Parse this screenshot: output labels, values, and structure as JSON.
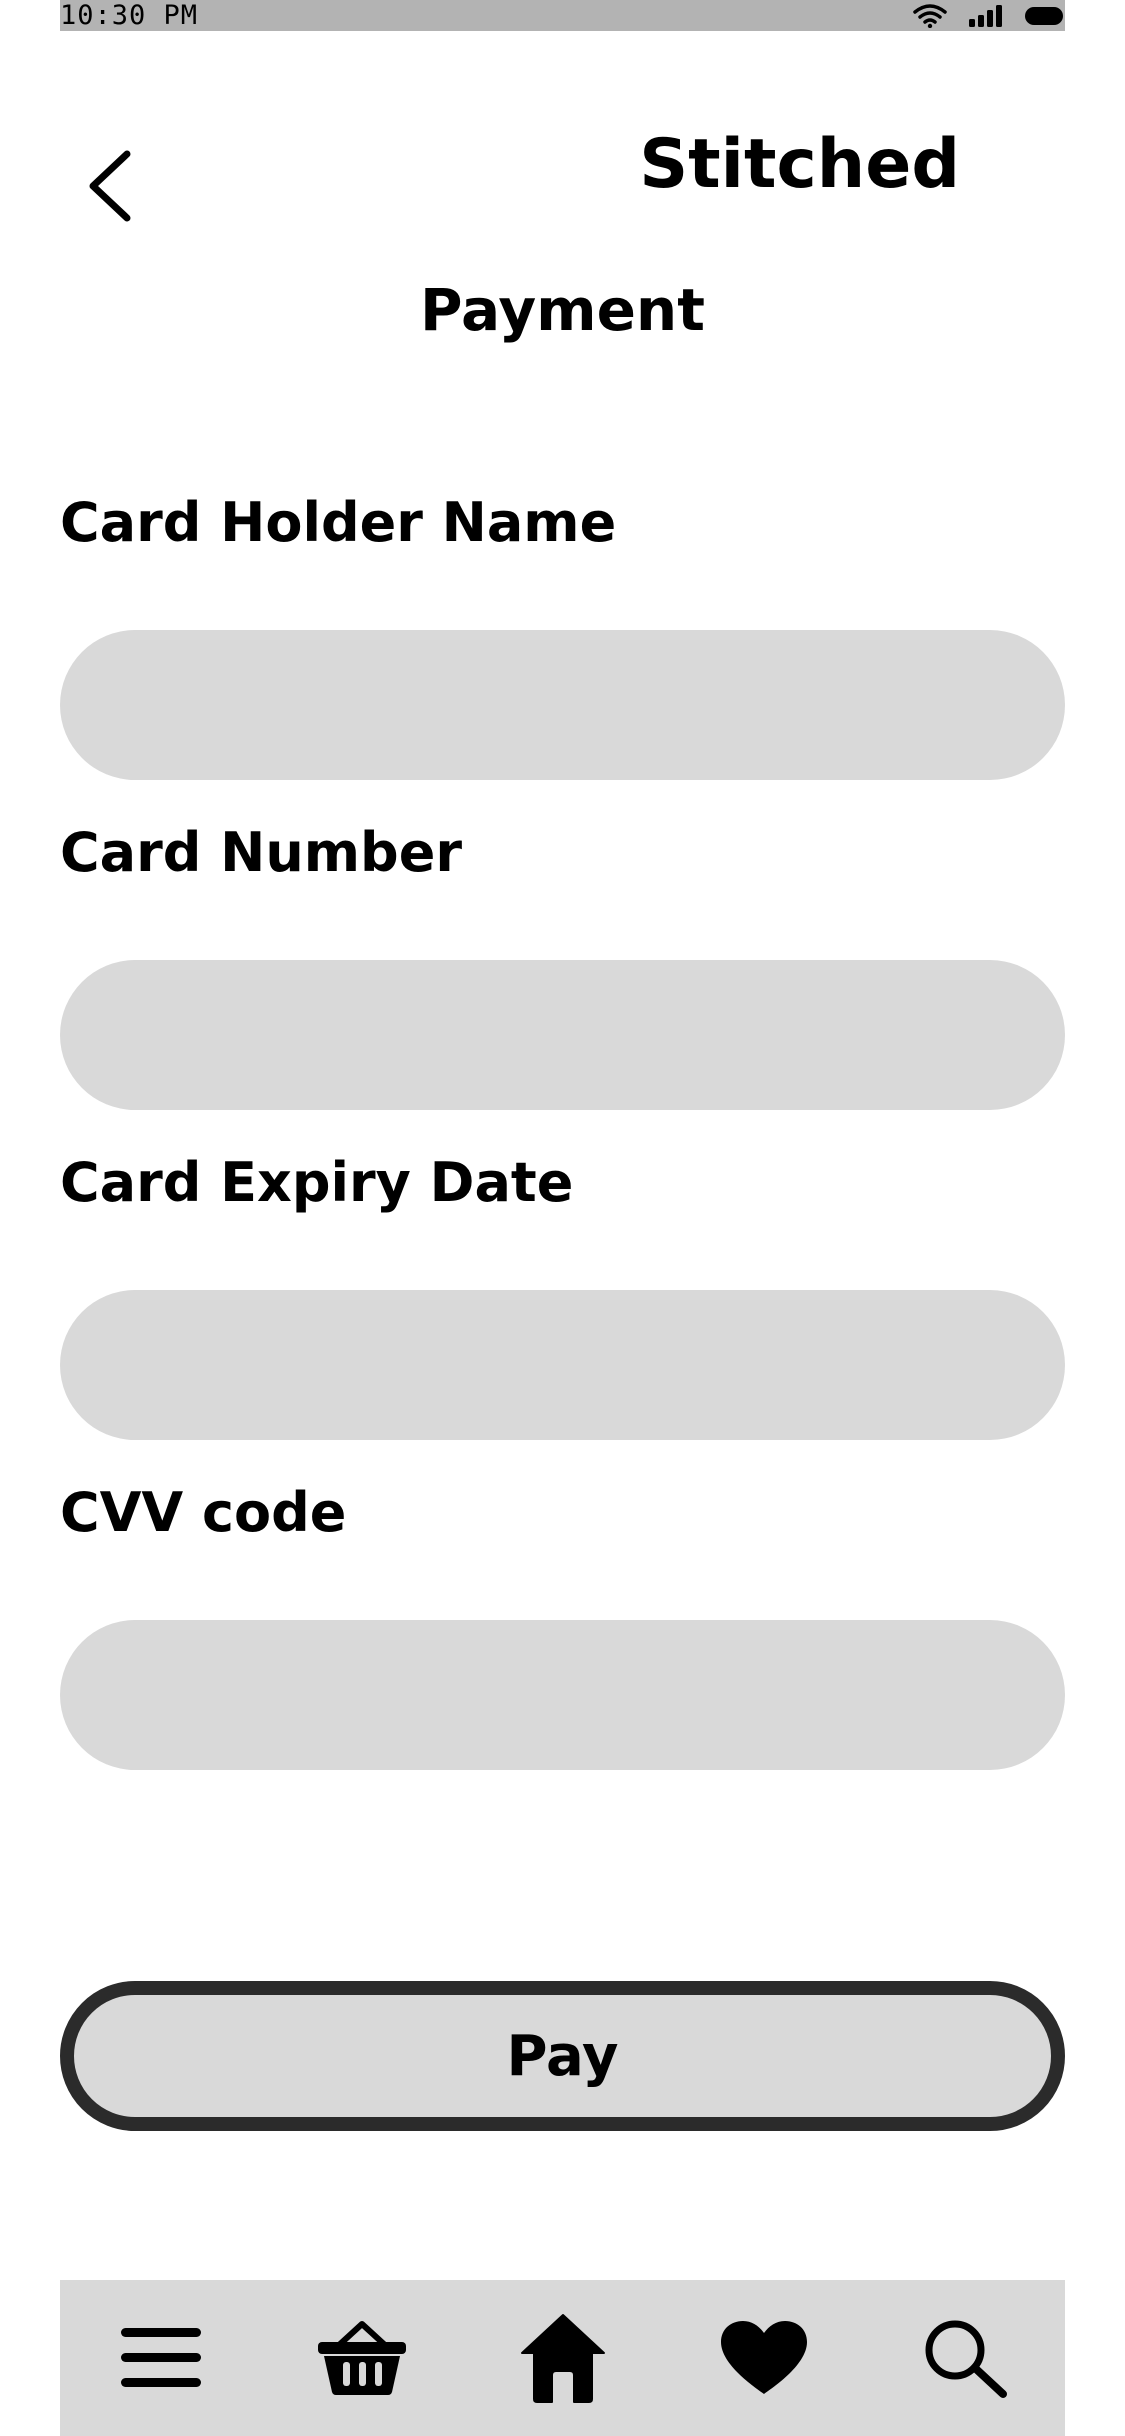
{
  "status_bar": {
    "time": "10:30 PM",
    "icons": [
      "wifi-icon",
      "signal-icon",
      "battery-icon"
    ]
  },
  "header": {
    "back_icon": "chevron-left-icon",
    "brand": "Stitched",
    "title": "Payment"
  },
  "form": {
    "fields": [
      {
        "label": "Card Holder Name",
        "value": "",
        "placeholder": ""
      },
      {
        "label": "Card Number",
        "value": "",
        "placeholder": ""
      },
      {
        "label": "Card Expiry Date",
        "value": "",
        "placeholder": ""
      },
      {
        "label": "CVV code",
        "value": "",
        "placeholder": ""
      }
    ],
    "pay_label": "Pay"
  },
  "bottom_nav": {
    "items": [
      {
        "icon": "menu-icon"
      },
      {
        "icon": "basket-icon"
      },
      {
        "icon": "home-icon"
      },
      {
        "icon": "heart-icon"
      },
      {
        "icon": "search-icon"
      }
    ]
  },
  "colors": {
    "status_bar_bg": "#b3b3b3",
    "input_bg": "#d9d9d9",
    "button_border": "#2b2b2b",
    "nav_bg": "#d9d9d9"
  }
}
